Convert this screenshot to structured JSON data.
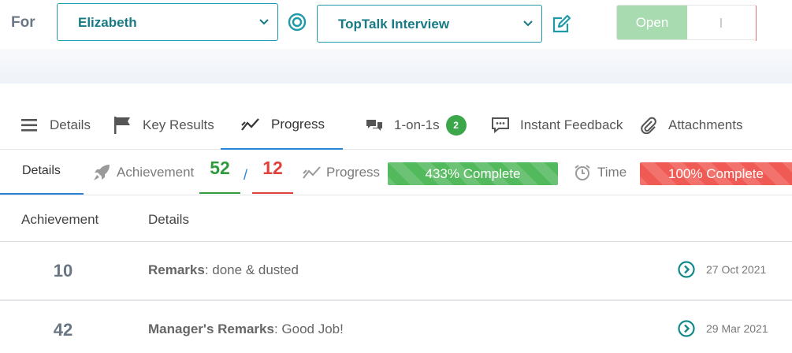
{
  "header": {
    "for_label": "For",
    "user_select": "Elizabeth",
    "type_select": "TopTalk Interview",
    "toggle_on_label": "Open"
  },
  "tabs": [
    {
      "label": "Details",
      "icon": "list-icon"
    },
    {
      "label": "Key Results",
      "icon": "flag-icon"
    },
    {
      "label": "Progress",
      "icon": "trend-icon",
      "active": true
    },
    {
      "label": "1-on-1s",
      "icon": "chat-icon",
      "badge": "2"
    },
    {
      "label": "Instant Feedback",
      "icon": "feedback-icon"
    },
    {
      "label": "Attachments",
      "icon": "paperclip-icon"
    }
  ],
  "subtabs": {
    "details": "Details",
    "achievement_label": "Achievement",
    "achieved": "52",
    "separator": "/",
    "target": "12",
    "progress_label": "Progress",
    "progress_bar": "433% Complete",
    "time_label": "Time",
    "time_bar": "100% Complete"
  },
  "table": {
    "headers": [
      "Achievement",
      "Details"
    ],
    "rows": [
      {
        "achievement": "10",
        "label": "Remarks",
        "text": ": done & dusted",
        "date": "27 Oct 2021"
      },
      {
        "achievement": "42",
        "label": "Manager's Remarks",
        "text": ": Good Job!",
        "date": "29 Mar 2021"
      }
    ]
  },
  "colors": {
    "accent": "#1e9aa8",
    "active_tab": "#2a85d6",
    "success": "#53b95d",
    "danger": "#f05a54"
  }
}
